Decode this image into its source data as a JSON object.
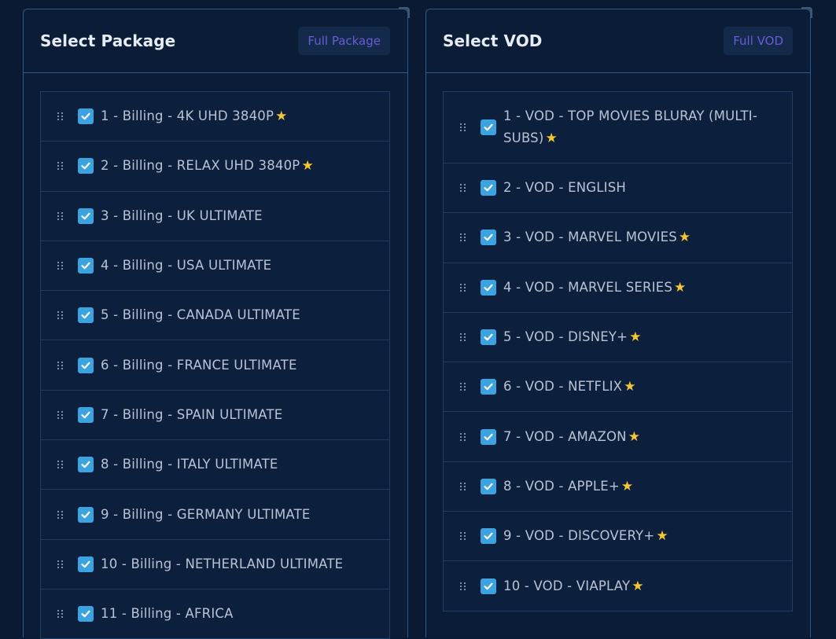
{
  "package": {
    "title": "Select Package",
    "button": "Full Package",
    "items": [
      {
        "label": "1 - Billing - 4K UHD 3840P",
        "star": "★"
      },
      {
        "label": "2 - Billing - RELAX UHD 3840P",
        "star": "★"
      },
      {
        "label": "3 - Billing - UK ULTIMATE",
        "star": ""
      },
      {
        "label": "4 - Billing - USA ULTIMATE",
        "star": ""
      },
      {
        "label": "5 - Billing - CANADA ULTIMATE",
        "star": ""
      },
      {
        "label": "6 - Billing - FRANCE ULTIMATE",
        "star": ""
      },
      {
        "label": "7 - Billing - SPAIN ULTIMATE",
        "star": ""
      },
      {
        "label": "8 - Billing - ITALY ULTIMATE",
        "star": ""
      },
      {
        "label": "9 - Billing - GERMANY ULTIMATE",
        "star": ""
      },
      {
        "label": "10 - Billing - NETHERLAND ULTIMATE",
        "star": ""
      },
      {
        "label": "11 - Billing - AFRICA",
        "star": ""
      }
    ]
  },
  "vod": {
    "title": "Select VOD",
    "button": "Full VOD",
    "items": [
      {
        "label": "1 - VOD - TOP MOVIES BLURAY (MULTI-SUBS)",
        "star": "★"
      },
      {
        "label": "2 - VOD - ENGLISH",
        "star": ""
      },
      {
        "label": "3 - VOD - MARVEL MOVIES",
        "star": "★"
      },
      {
        "label": "4 - VOD - MARVEL SERIES",
        "star": "★"
      },
      {
        "label": "5 - VOD - DISNEY+",
        "star": "★"
      },
      {
        "label": "6 - VOD - NETFLIX",
        "star": "★"
      },
      {
        "label": "7 - VOD - AMAZON",
        "star": "★"
      },
      {
        "label": "8 - VOD - APPLE+",
        "star": "★"
      },
      {
        "label": "9 - VOD - DISCOVERY+",
        "star": "★"
      },
      {
        "label": "10 - VOD - VIAPLAY",
        "star": "★"
      }
    ]
  },
  "colors": {
    "background": "#0a1a33",
    "panel_border": "#2b5a87",
    "checkbox": "#3aa3e0",
    "star": "#f6c534",
    "button_text": "#6a5bd6"
  }
}
